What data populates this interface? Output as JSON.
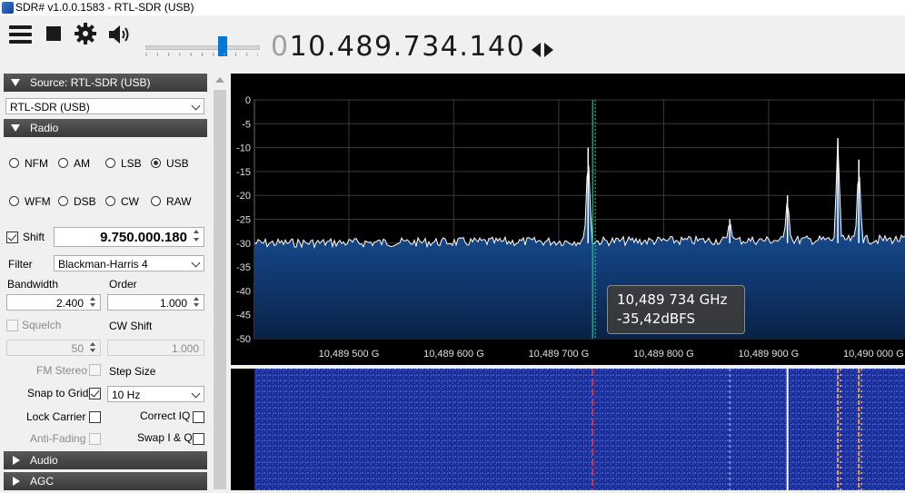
{
  "window": {
    "title": "SDR# v1.0.0.1583 - RTL-SDR (USB)"
  },
  "toolbar": {
    "menu_icon": "hamburger-icon",
    "stop_icon": "stop-icon",
    "settings_icon": "gear-icon",
    "audio_icon": "speaker-icon",
    "volume_level": 0.7,
    "frequency_lead": "0",
    "frequency_main": "10.489.734.140",
    "tuning_icon": "left-right-arrows-icon"
  },
  "source": {
    "header": "Source: RTL-SDR (USB)",
    "device": "RTL-SDR (USB)"
  },
  "radio": {
    "header": "Radio",
    "modes_row1": [
      {
        "label": "NFM",
        "selected": false
      },
      {
        "label": "AM",
        "selected": false
      },
      {
        "label": "LSB",
        "selected": false
      },
      {
        "label": "USB",
        "selected": true
      }
    ],
    "modes_row2": [
      {
        "label": "WFM",
        "selected": false
      },
      {
        "label": "DSB",
        "selected": false
      },
      {
        "label": "CW",
        "selected": false
      },
      {
        "label": "RAW",
        "selected": false
      }
    ],
    "shift_label": "Shift",
    "shift_checked": true,
    "shift_value": "9.750.000.180",
    "filter_label": "Filter",
    "filter_value": "Blackman-Harris 4",
    "bandwidth_label": "Bandwidth",
    "bandwidth_value": "2.400",
    "order_label": "Order",
    "order_value": "1.000",
    "squelch_label": "Squelch",
    "squelch_value": "50",
    "cw_shift_label": "CW Shift",
    "cw_shift_value": "1.000",
    "fm_stereo_label": "FM Stereo",
    "step_size_label": "Step Size",
    "snap_label": "Snap to Grid",
    "snap_checked": true,
    "step_value": "10 Hz",
    "lock_carrier_label": "Lock Carrier",
    "correct_iq_label": "Correct IQ",
    "anti_fading_label": "Anti-Fading",
    "swap_iq_label": "Swap I & Q"
  },
  "audio": {
    "header": "Audio"
  },
  "agc": {
    "header": "AGC"
  },
  "spectrum": {
    "y_ticks": [
      "0",
      "-5",
      "-10",
      "-15",
      "-20",
      "-25",
      "-30",
      "-35",
      "-40",
      "-45",
      "-50"
    ],
    "x_ticks": [
      "10,489 500 G",
      "10,489 600 G",
      "10,489 700 G",
      "10,489 800 G",
      "10,489 900 G",
      "10,490 000 G"
    ],
    "tooltip_freq": "10,489 734 GHz",
    "tooltip_level": "-35,42dBFS"
  },
  "colors": {
    "panel_header": "#444444",
    "spectrum_fill": "#1a4f8f",
    "waterfall_bg": "#1c2f9a",
    "accent": "#0078d7"
  },
  "chart_data": {
    "type": "area",
    "ylim": [
      -50,
      0
    ],
    "xlim": [
      10.48941,
      10.49003
    ],
    "x_units": "GHz",
    "noise_floor_dbfs": -30,
    "tuned_frequency": 10.489734,
    "peaks": [
      {
        "x": 10.489728,
        "y": -10
      },
      {
        "x": 10.489863,
        "y": -25
      },
      {
        "x": 10.489918,
        "y": -20
      },
      {
        "x": 10.489966,
        "y": -8
      },
      {
        "x": 10.489986,
        "y": -12.5
      }
    ]
  }
}
